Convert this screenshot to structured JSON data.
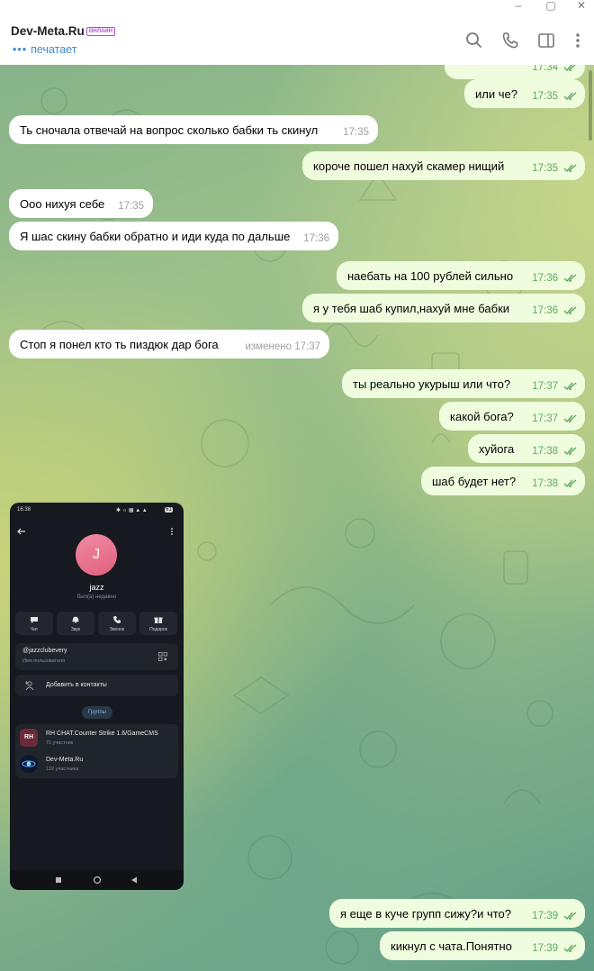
{
  "header": {
    "title": "Dev-Meta.Ru",
    "badge": "ОНЛАЙН",
    "status": "печатает",
    "status_dots": "•••"
  },
  "messages": [
    {
      "dir": "out",
      "text": "",
      "time": "17:34"
    },
    {
      "dir": "out",
      "text": "или че?",
      "time": "17:35"
    },
    {
      "dir": "in",
      "text": "Ть сночала отвечай на вопрос сколько бабки ть скинул",
      "time": "17:35"
    },
    {
      "dir": "out",
      "text": "короче пошел нахуй скамер нищий",
      "time": "17:35"
    },
    {
      "dir": "in",
      "text": "Ооо нихуя себе",
      "time": "17:35"
    },
    {
      "dir": "in",
      "text": "Я шас скину бабки обратно и иди куда по дальше",
      "time": "17:36"
    },
    {
      "dir": "out",
      "text": "наебать на 100 рублей сильно",
      "time": "17:36"
    },
    {
      "dir": "out",
      "text": "я у тебя шаб купил,нахуй мне бабки",
      "time": "17:36"
    },
    {
      "dir": "in",
      "text": "Стоп я понел кто ть пиздюк дар бога",
      "time": "изменено 17:37"
    },
    {
      "dir": "out",
      "text": "ты реально укурыш или что?",
      "time": "17:37"
    },
    {
      "dir": "out",
      "text": "какой бога?",
      "time": "17:37"
    },
    {
      "dir": "out",
      "text": "хуйога",
      "time": "17:38"
    },
    {
      "dir": "out",
      "text": "шаб будет нет?",
      "time": "17:38"
    },
    {
      "dir": "out",
      "text": "я еще в куче групп сижу?и что?",
      "time": "17:39"
    },
    {
      "dir": "out",
      "text": "кикнул с чата.Понятно",
      "time": "17:39"
    }
  ],
  "screenshot": {
    "clock": "16:38",
    "battery": "61",
    "avatar_letter": "J",
    "name": "jazz",
    "last_seen": "был(а) недавно",
    "actions": [
      "Чат",
      "Звук",
      "Звонок",
      "Подарок"
    ],
    "username": "@jazzclubevery",
    "username_label": "Имя пользователя",
    "add_contact": "Добавить в контакты",
    "groups_tab": "Группы",
    "groups": [
      {
        "name": "RH CHAT.Counter Strike 1.6/GameCMS",
        "count": "71 участник",
        "icon_text": "RH"
      },
      {
        "name": "Dev-Meta.Ru",
        "count": "132 участника",
        "icon_text": ""
      }
    ]
  },
  "colors": {
    "accent": "#3a8bd1",
    "out_bubble": "#effdde",
    "in_bubble": "#ffffff",
    "read_ticks": "#5fa860",
    "avatar": "#e9708f"
  }
}
